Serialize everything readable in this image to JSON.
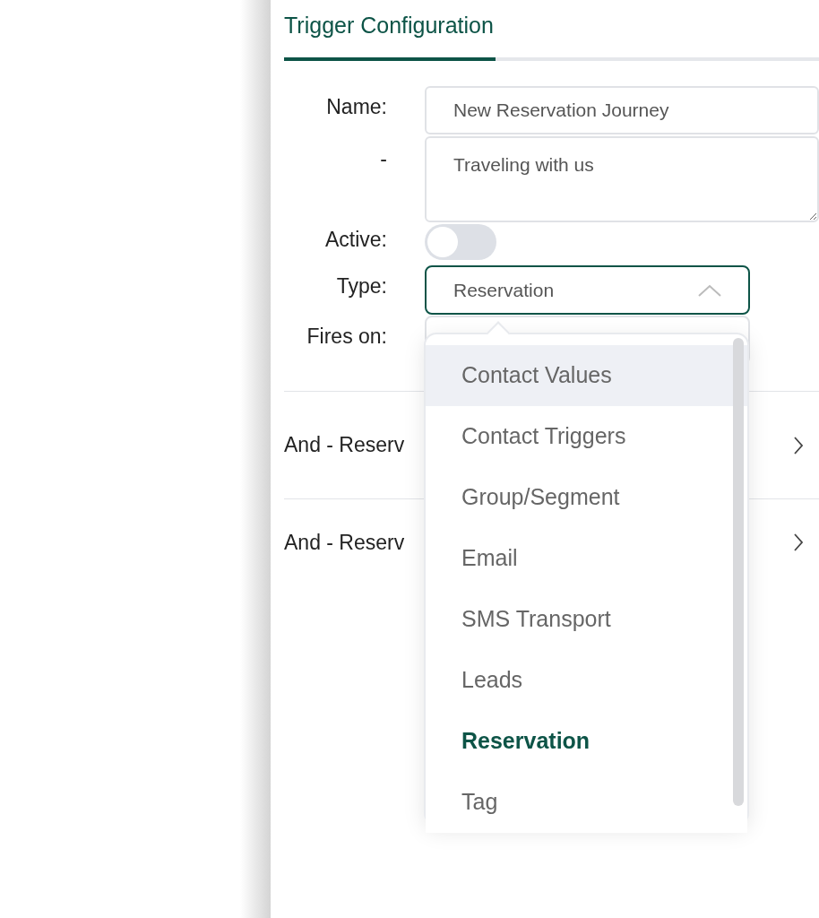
{
  "tab": {
    "label": "Trigger Configuration",
    "selected": true
  },
  "form": {
    "fields": [
      {
        "kind": "text",
        "label": "Name:",
        "value": "New Reservation Journey"
      },
      {
        "kind": "textarea",
        "label": "-",
        "value": "Traveling with us"
      },
      {
        "kind": "toggle",
        "label": "Active:",
        "on": false
      },
      {
        "kind": "select",
        "label": "Type:",
        "value": "Reservation",
        "expanded": true
      },
      {
        "kind": "select",
        "label": "Fires on:"
      }
    ]
  },
  "conditions": [
    {
      "label": "And - Reserv"
    },
    {
      "label": "And - Reserv"
    }
  ],
  "dropdown": {
    "options": [
      {
        "label": "Contact Values",
        "highlighted": true,
        "selected": false
      },
      {
        "label": "Contact Triggers",
        "highlighted": false,
        "selected": false
      },
      {
        "label": "Group/Segment",
        "highlighted": false,
        "selected": false
      },
      {
        "label": "Email",
        "highlighted": false,
        "selected": false
      },
      {
        "label": "SMS Transport",
        "highlighted": false,
        "selected": false
      },
      {
        "label": "Leads",
        "highlighted": false,
        "selected": false
      },
      {
        "label": "Reservation",
        "highlighted": false,
        "selected": true
      },
      {
        "label": "Tag",
        "highlighted": false,
        "selected": false
      }
    ]
  }
}
